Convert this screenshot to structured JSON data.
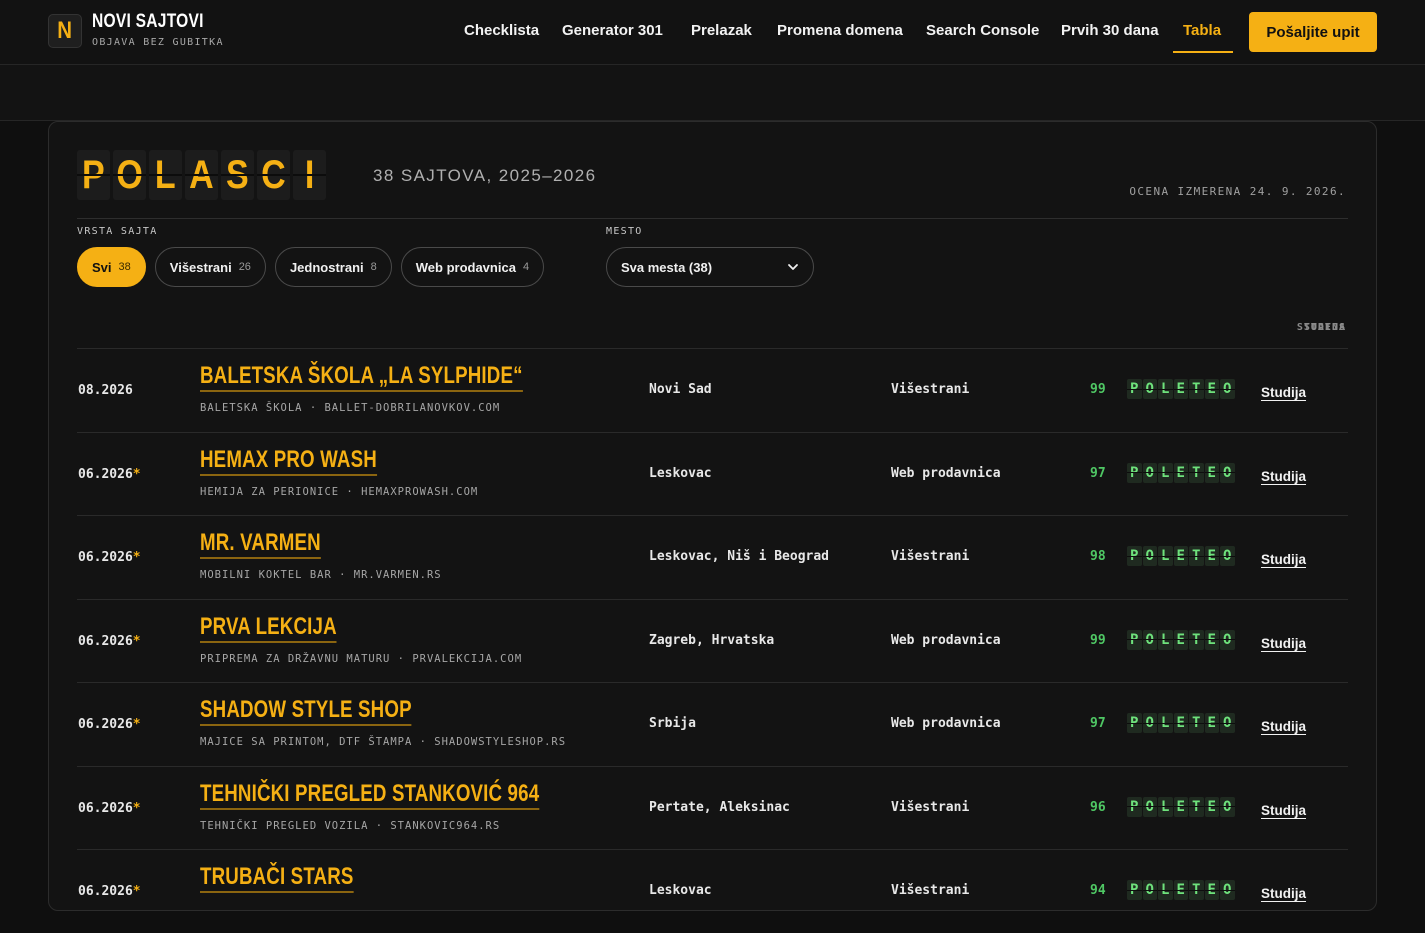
{
  "brand": {
    "logo_letter": "N",
    "name": "NOVI SAJTOVI",
    "tagline": "OBJAVA BEZ GUBITKA"
  },
  "nav": {
    "links": [
      "Checklista",
      "Generator 301",
      "Prelazak",
      "Promena domena",
      "Search Console",
      "Prvih 30 dana",
      "Tabla"
    ],
    "active": "Tabla",
    "cta": "Pošaljite upit"
  },
  "board": {
    "title_letters": [
      "P",
      "O",
      "L",
      "A",
      "S",
      "C",
      "I"
    ],
    "subtitle": "38 SAJTOVA, 2025–2026",
    "meta": "OCENA IZMERENA 24. 9. 2026.",
    "filters": {
      "type_label": "VRSTA SAJTA",
      "type_chips": [
        {
          "label": "Svi",
          "count": "38",
          "active": true
        },
        {
          "label": "Višestrani",
          "count": "26",
          "active": false
        },
        {
          "label": "Jednostrani",
          "count": "8",
          "active": false
        },
        {
          "label": "Web prodavnica",
          "count": "4",
          "active": false
        }
      ],
      "city_label": "MESTO",
      "city_value": "Sva mesta (38)"
    },
    "column_headers": [
      "STATUS",
      "OCENA",
      "STUDIJA"
    ],
    "status_letters": [
      "P",
      "O",
      "L",
      "E",
      "T",
      "E",
      "O"
    ],
    "rows": [
      {
        "date": "08.2026",
        "star": "",
        "name": "BALETSKA ŠKOLA „LA SYLPHIDE“",
        "desc": "BALETSKA ŠKOLA · BALLET-DOBRILANOVKOV.COM",
        "city": "Novi Sad",
        "type": "Višestrani",
        "score": "99",
        "link": "Studija"
      },
      {
        "date": "06.2026",
        "star": "*",
        "name": "HEMAX PRO WASH",
        "desc": "HEMIJA ZA PERIONICE · HEMAXPROWASH.COM",
        "city": "Leskovac",
        "type": "Web prodavnica",
        "score": "97",
        "link": "Studija"
      },
      {
        "date": "06.2026",
        "star": "*",
        "name": "MR. VARMEN",
        "desc": "MOBILNI KOKTEL BAR · MR.VARMEN.RS",
        "city": "Leskovac, Niš i Beograd",
        "type": "Višestrani",
        "score": "98",
        "link": "Studija"
      },
      {
        "date": "06.2026",
        "star": "*",
        "name": "PRVA LEKCIJA",
        "desc": "PRIPREMA ZA DRŽAVNU MATURU · PRVALEKCIJA.COM",
        "city": "Zagreb, Hrvatska",
        "type": "Web prodavnica",
        "score": "99",
        "link": "Studija"
      },
      {
        "date": "06.2026",
        "star": "*",
        "name": "SHADOW STYLE SHOP",
        "desc": "MAJICE SA PRINTOM, DTF ŠTAMPA · SHADOWSTYLESHOP.RS",
        "city": "Srbija",
        "type": "Web prodavnica",
        "score": "97",
        "link": "Studija"
      },
      {
        "date": "06.2026",
        "star": "*",
        "name": "TEHNIČKI PREGLED STANKOVIĆ 964",
        "desc": "TEHNIČKI PREGLED VOZILA · STANKOVIC964.RS",
        "city": "Pertate, Aleksinac",
        "type": "Višestrani",
        "score": "96",
        "link": "Studija"
      },
      {
        "date": "06.2026",
        "star": "*",
        "name": "TRUBAČI STARS",
        "desc": "",
        "city": "Leskovac",
        "type": "Višestrani",
        "score": "94",
        "link": "Studija"
      }
    ]
  },
  "colors": {
    "accent": "#f5b014",
    "score_green": "#4fc764",
    "status_green": "#6ee27c",
    "background": "#0f0f0f"
  }
}
